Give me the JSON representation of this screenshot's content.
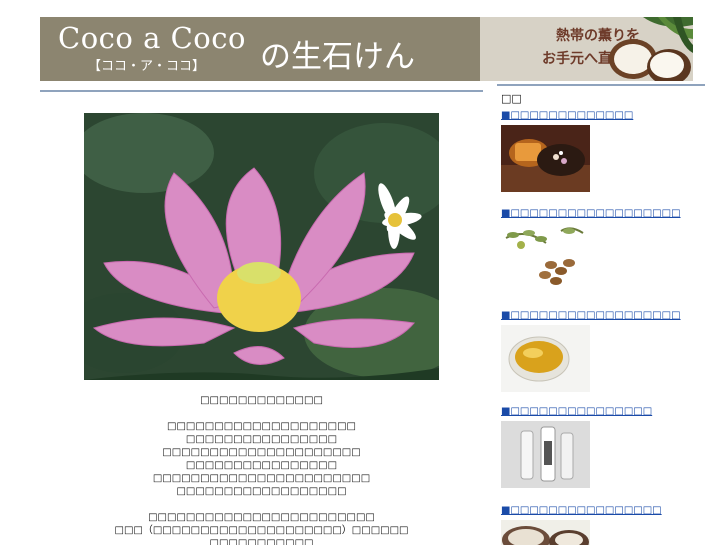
{
  "banner": {
    "logo_main": "Coco a Coco",
    "logo_sub": "【ココ・ア・ココ】",
    "logo_tail": "の生石けん",
    "tagline_line1": "熱帯の薫りを",
    "tagline_line2": "お手元へ直送！"
  },
  "article": {
    "caption": "□□□□□□□□□□□□□",
    "paragraph1": [
      "□□□□□□□□□□□□□□□□□□□□",
      "□□□□□□□□□□□□□□□□",
      "□□□□□□□□□□□□□□□□□□□□□",
      "□□□□□□□□□□□□□□□□",
      "□□□□□□□□□□□□□□□□□□□□□□□",
      "□□□□□□□□□□□□□□□□□□"
    ],
    "paragraph2": [
      "□□□□□□□□□□□□□□□□□□□□□□□□",
      "□□□（□□□□□□□□□□□□□□□□□□□□）□□□□□□",
      "□□□□□□□□□□□"
    ]
  },
  "sidebar": {
    "title": "□□",
    "items": [
      {
        "label": "■□□□□□□□□□□□□□"
      },
      {
        "label": "■□□□□□□□□□□□□□□□□□□"
      },
      {
        "label": "■□□□□□□□□□□□□□□□□□□"
      },
      {
        "label": "■□□□□□□□□□□□□□□□"
      },
      {
        "label": "■□□□□□□□□□□□□□□□□"
      }
    ]
  }
}
